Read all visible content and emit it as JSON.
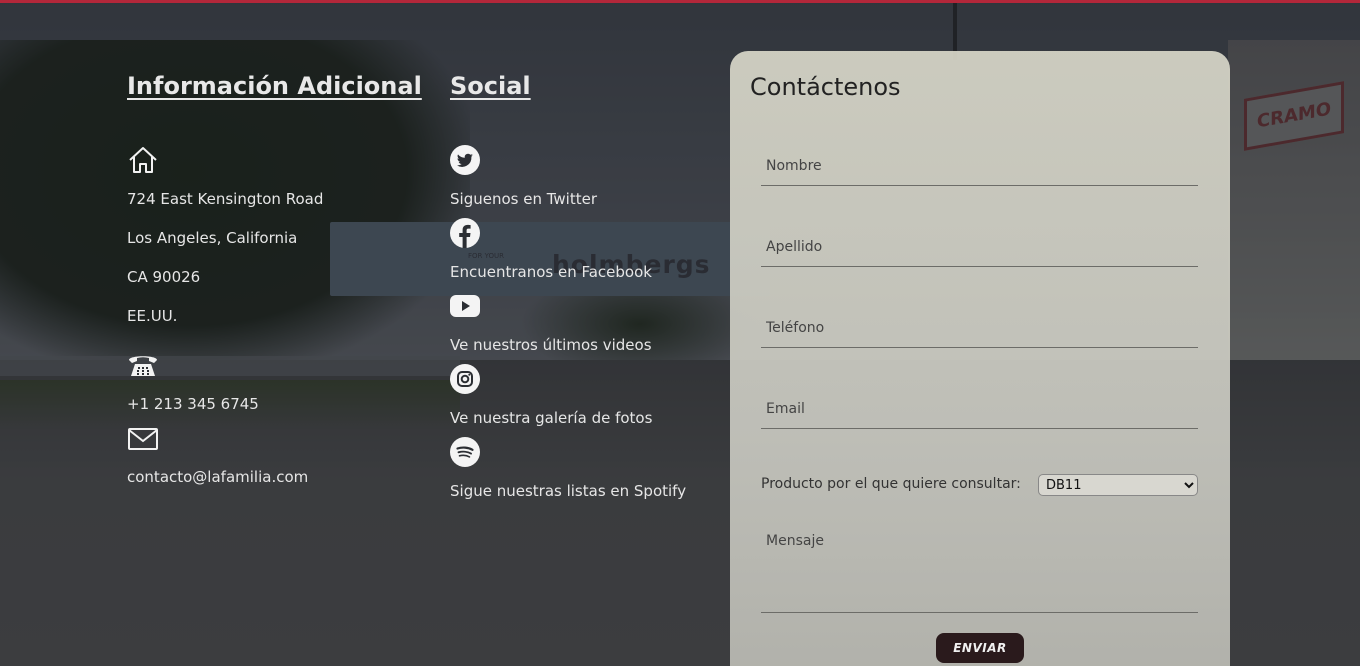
{
  "info": {
    "title": "Información Adicional",
    "address_lines": [
      "724 East Kensington Road",
      "Los Angeles, California",
      "CA 90026",
      "EE.UU."
    ],
    "phone": "+1 213 345 6745",
    "email": "contacto@lafamilia.com"
  },
  "social": {
    "title": "Social",
    "items": [
      {
        "icon": "twitter-icon",
        "label": "Siguenos en Twitter"
      },
      {
        "icon": "facebook-icon",
        "label": "Encuentranos en Facebook"
      },
      {
        "icon": "youtube-icon",
        "label": "Ve nuestros últimos videos"
      },
      {
        "icon": "instagram-icon",
        "label": "Ve nuestra galería de fotos"
      },
      {
        "icon": "spotify-icon",
        "label": "Sigue nuestras listas en Spotify"
      }
    ]
  },
  "contact": {
    "title": "Contáctenos",
    "nombre_placeholder": "Nombre",
    "apellido_placeholder": "Apellido",
    "telefono_placeholder": "Teléfono",
    "email_placeholder": "Email",
    "product_label": "Producto por el que quiere consultar:",
    "product_selected": "DB11",
    "mensaje_placeholder": "Mensaje",
    "submit_label": "ENVIAR"
  },
  "background": {
    "bridge_text": "holmbergs",
    "bridge_small": "FOR YOUR",
    "sign_text": "CRAMO"
  },
  "colors": {
    "accent_bar": "#b3273a",
    "submit_bg": "#2a1a1c"
  }
}
